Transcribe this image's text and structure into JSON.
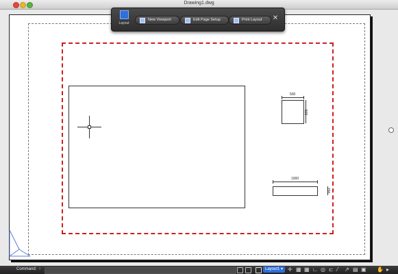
{
  "window": {
    "title": "Drawing1.dwg"
  },
  "layout_toolbar": {
    "layout_label": "Layout",
    "new_viewport_label": "New Viewport",
    "edit_page_setup_label": "Edit Page Setup",
    "print_layout_label": "Print Layout",
    "close_glyph": "✕"
  },
  "drawing": {
    "square_width": "500",
    "square_height": "500",
    "rect_width": "1000",
    "rect_height": "150"
  },
  "statusbar": {
    "command_label": "Command:",
    "command_chevron": "›",
    "command_value": "",
    "layout_tab": "Layout1 ▾"
  },
  "colors": {
    "border_red": "#cc1f1f",
    "toolbar_bg": "#3a3a3a",
    "accent_blue": "#2f6fd8"
  },
  "icons": [
    "layout-icon",
    "new-viewport-icon",
    "page-setup-icon",
    "print-icon",
    "close-icon",
    "ucs-icon",
    "crosshair-cursor"
  ]
}
